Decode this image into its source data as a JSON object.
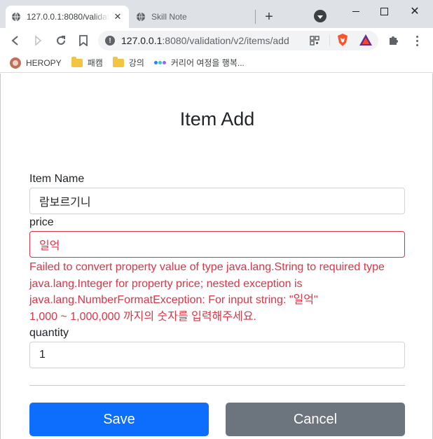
{
  "browser": {
    "tabs": [
      {
        "title": "127.0.0.1:8080/validation/v2/items/add",
        "active": true
      },
      {
        "title": "Skill Note",
        "active": false
      }
    ],
    "address": {
      "host": "127.0.0.1",
      "rest": ":8080/validation/v2/items/add"
    },
    "bookmarks": [
      {
        "label": "HEROPY",
        "icon": "avatar-icon"
      },
      {
        "label": "패캠",
        "icon": "folder-icon"
      },
      {
        "label": "강의",
        "icon": "folder-icon"
      },
      {
        "label": "커리어 여정을 행복...",
        "icon": "dots-icon"
      }
    ]
  },
  "page": {
    "title": "Item Add",
    "fields": {
      "item_name": {
        "label": "Item Name",
        "value": "람보르기니"
      },
      "price": {
        "label": "price",
        "value": "일억",
        "errors": [
          "Failed to convert property value of type java.lang.String to required type java.lang.Integer for property price; nested exception is java.lang.NumberFormatException: For input string: \"일억\"",
          "1,000 ~ 1,000,000 까지의 숫자를 입력해주세요."
        ]
      },
      "quantity": {
        "label": "quantity",
        "value": "1"
      }
    },
    "buttons": {
      "save": "Save",
      "cancel": "Cancel"
    }
  },
  "colors": {
    "primary": "#0d6efd",
    "secondary": "#6c757d",
    "danger": "#dc3545"
  }
}
